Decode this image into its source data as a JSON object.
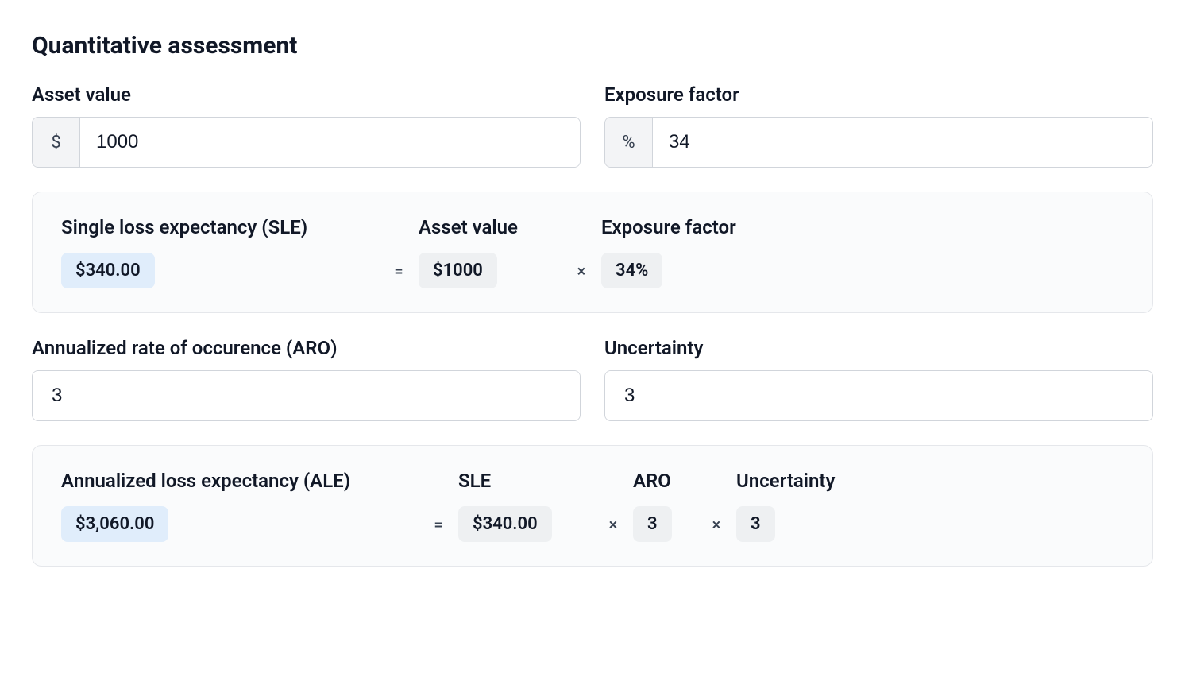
{
  "title": "Quantitative assessment",
  "inputs": {
    "asset_value": {
      "label": "Asset value",
      "prefix": "$",
      "value": "1000"
    },
    "exposure_factor": {
      "label": "Exposure factor",
      "prefix": "%",
      "value": "34"
    },
    "aro": {
      "label": "Annualized rate of occurence (ARO)",
      "value": "3"
    },
    "uncertainty": {
      "label": "Uncertainty",
      "value": "3"
    }
  },
  "sle_card": {
    "result_label": "Single loss expectancy (SLE)",
    "asset_label": "Asset value",
    "ef_label": "Exposure factor",
    "result_value": "$340.00",
    "asset_value": "$1000",
    "ef_value": "34%",
    "eq": "=",
    "times": "×"
  },
  "ale_card": {
    "result_label": "Annualized loss expectancy (ALE)",
    "sle_label": "SLE",
    "aro_label": "ARO",
    "unc_label": "Uncertainty",
    "result_value": "$3,060.00",
    "sle_value": "$340.00",
    "aro_value": "3",
    "unc_value": "3",
    "eq": "=",
    "times": "×"
  }
}
